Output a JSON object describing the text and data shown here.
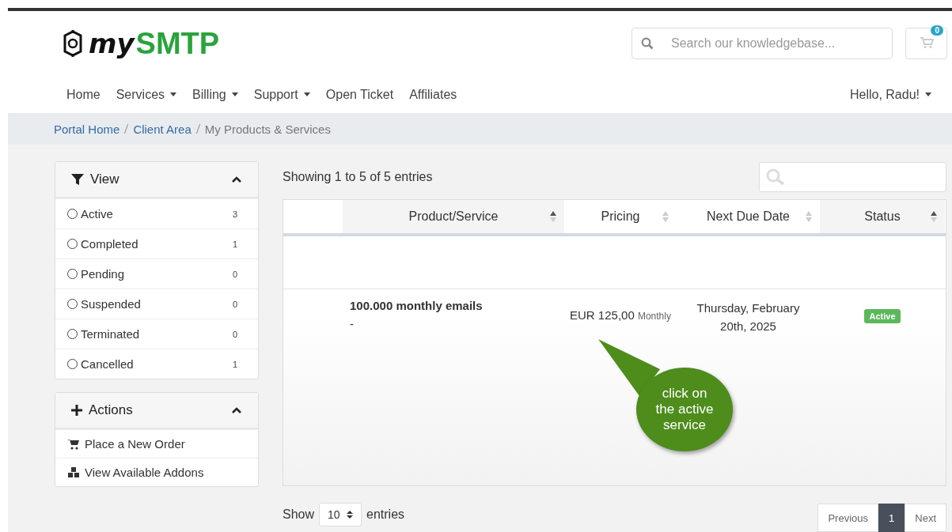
{
  "logo": {
    "prefix": "my",
    "name": "SMTP"
  },
  "search": {
    "placeholder": "Search our knowledgebase..."
  },
  "cart": {
    "count": "0"
  },
  "nav": [
    {
      "label": "Home",
      "dropdown": false
    },
    {
      "label": "Services",
      "dropdown": true
    },
    {
      "label": "Billing",
      "dropdown": true
    },
    {
      "label": "Support",
      "dropdown": true
    },
    {
      "label": "Open Ticket",
      "dropdown": false
    },
    {
      "label": "Affiliates",
      "dropdown": false
    }
  ],
  "user_menu": {
    "label": "Hello, Radu!",
    "dropdown": true
  },
  "breadcrumb": [
    {
      "label": "Portal Home",
      "link": true
    },
    {
      "label": "Client Area",
      "link": true
    },
    {
      "label": "My Products & Services",
      "link": false
    }
  ],
  "view_panel": {
    "title": "View",
    "expanded": true,
    "filters": [
      {
        "label": "Active",
        "count": "3",
        "selected": false
      },
      {
        "label": "Completed",
        "count": "1",
        "selected": false
      },
      {
        "label": "Pending",
        "count": "0",
        "selected": false
      },
      {
        "label": "Suspended",
        "count": "0",
        "selected": false
      },
      {
        "label": "Terminated",
        "count": "0",
        "selected": false
      },
      {
        "label": "Cancelled",
        "count": "1",
        "selected": false
      }
    ]
  },
  "actions_panel": {
    "title": "Actions",
    "expanded": true,
    "items": [
      {
        "label": "Place a New Order",
        "kind": "cart"
      },
      {
        "label": "View Available Addons",
        "kind": "addons"
      }
    ]
  },
  "table_info": "Showing 1 to 5 of 5 entries",
  "table": {
    "columns": [
      {
        "label": "Product/Service",
        "sorted_ascending": true
      },
      {
        "label": "Pricing",
        "sorted_ascending": false
      },
      {
        "label": "Next Due Date",
        "sorted_ascending": false
      },
      {
        "label": "Status",
        "sorted_ascending": true
      }
    ],
    "rows": [
      {
        "product": "100.000 monthly emails",
        "domain": "-",
        "price": "EUR 125,00",
        "cycle": "Monthly",
        "due": "Thursday, February 20th, 2025",
        "status": "Active"
      }
    ]
  },
  "callout": {
    "text": "click on the active service"
  },
  "length_menu": {
    "before": "Show",
    "value": "10",
    "after": "entries"
  },
  "pagination": [
    {
      "label": "Previous",
      "selected": false
    },
    {
      "label": "1",
      "selected": true
    },
    {
      "label": "Next",
      "selected": false
    }
  ]
}
